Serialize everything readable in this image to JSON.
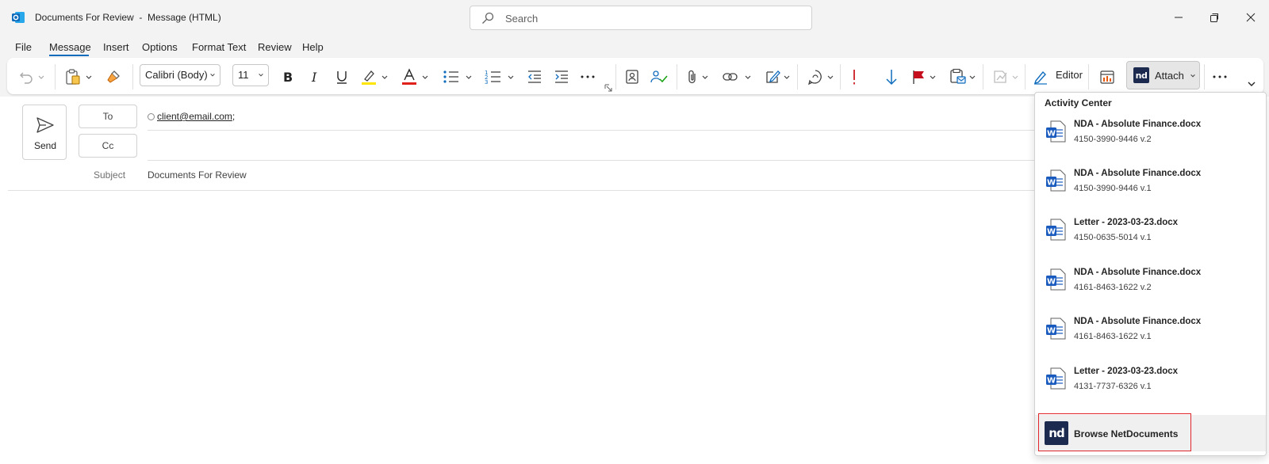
{
  "window": {
    "title": "Documents For Review  -  Message (HTML)",
    "search_placeholder": "Search"
  },
  "menu": {
    "items": [
      "File",
      "Message",
      "Insert",
      "Options",
      "Format Text",
      "Review",
      "Help"
    ],
    "active": "Message"
  },
  "ribbon": {
    "font_name": "Calibri (Body)",
    "font_size": "11",
    "editor_label": "Editor",
    "attach_label": "Attach",
    "nd_logo": "nd"
  },
  "compose": {
    "send_label": "Send",
    "to_label": "To",
    "cc_label": "Cc",
    "recipient": "client@email.com",
    "recipient_sep": ";",
    "subject_label": "Subject",
    "subject_value": "Documents For Review"
  },
  "activity_center": {
    "title": "Activity Center",
    "documents": [
      {
        "name": "NDA - Absolute Finance.docx",
        "number": "4150-3990-9446 v.2"
      },
      {
        "name": "NDA - Absolute Finance.docx",
        "number": "4150-3990-9446 v.1"
      },
      {
        "name": "Letter - 2023-03-23.docx",
        "number": "4150-0635-5014 v.1"
      },
      {
        "name": "NDA - Absolute Finance.docx",
        "number": "4161-8463-1622 v.2"
      },
      {
        "name": "NDA - Absolute Finance.docx",
        "number": "4161-8463-1622 v.1"
      },
      {
        "name": "Letter - 2023-03-23.docx",
        "number": "4131-7737-6326 v.1"
      }
    ],
    "browse_label": "Browse NetDocuments",
    "browse_logo": "nd"
  },
  "colors": {
    "accent": "#0f6cbd",
    "word_blue": "#185abd",
    "nd_navy": "#1b2a4e",
    "highlight_red": "#e0262d",
    "importance_red": "#d13438",
    "flag_red": "#c50f1f"
  }
}
